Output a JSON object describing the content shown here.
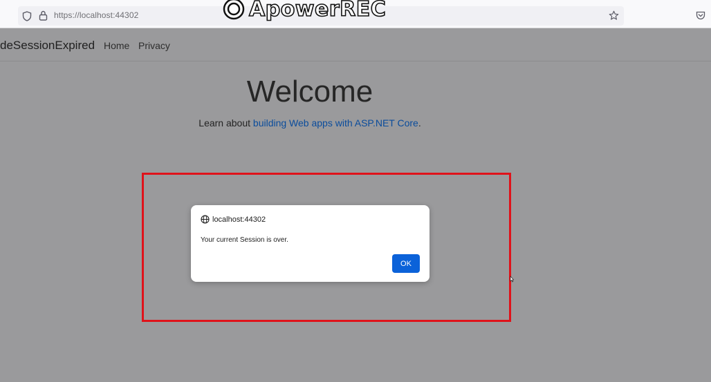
{
  "browser": {
    "url": "https://localhost:44302"
  },
  "watermark": {
    "text": "ApowerREC"
  },
  "site": {
    "brand": "deSessionExpired",
    "nav": [
      {
        "label": "Home"
      },
      {
        "label": "Privacy"
      }
    ]
  },
  "main": {
    "title": "Welcome",
    "lead_prefix": "Learn about ",
    "lead_link": "building Web apps with ASP.NET Core",
    "lead_suffix": "."
  },
  "dialog": {
    "origin": "localhost:44302",
    "message": "Your current Session is over.",
    "ok_label": "OK"
  },
  "colors": {
    "overlay_bg": "#9a9a9c",
    "highlight_border": "#e0121a",
    "ok_button": "#0b62d9",
    "link": "#0a4c9c"
  },
  "icons": [
    "shield-icon",
    "lock-icon",
    "star-icon",
    "pocket-icon",
    "globe-icon",
    "cursor-icon"
  ]
}
